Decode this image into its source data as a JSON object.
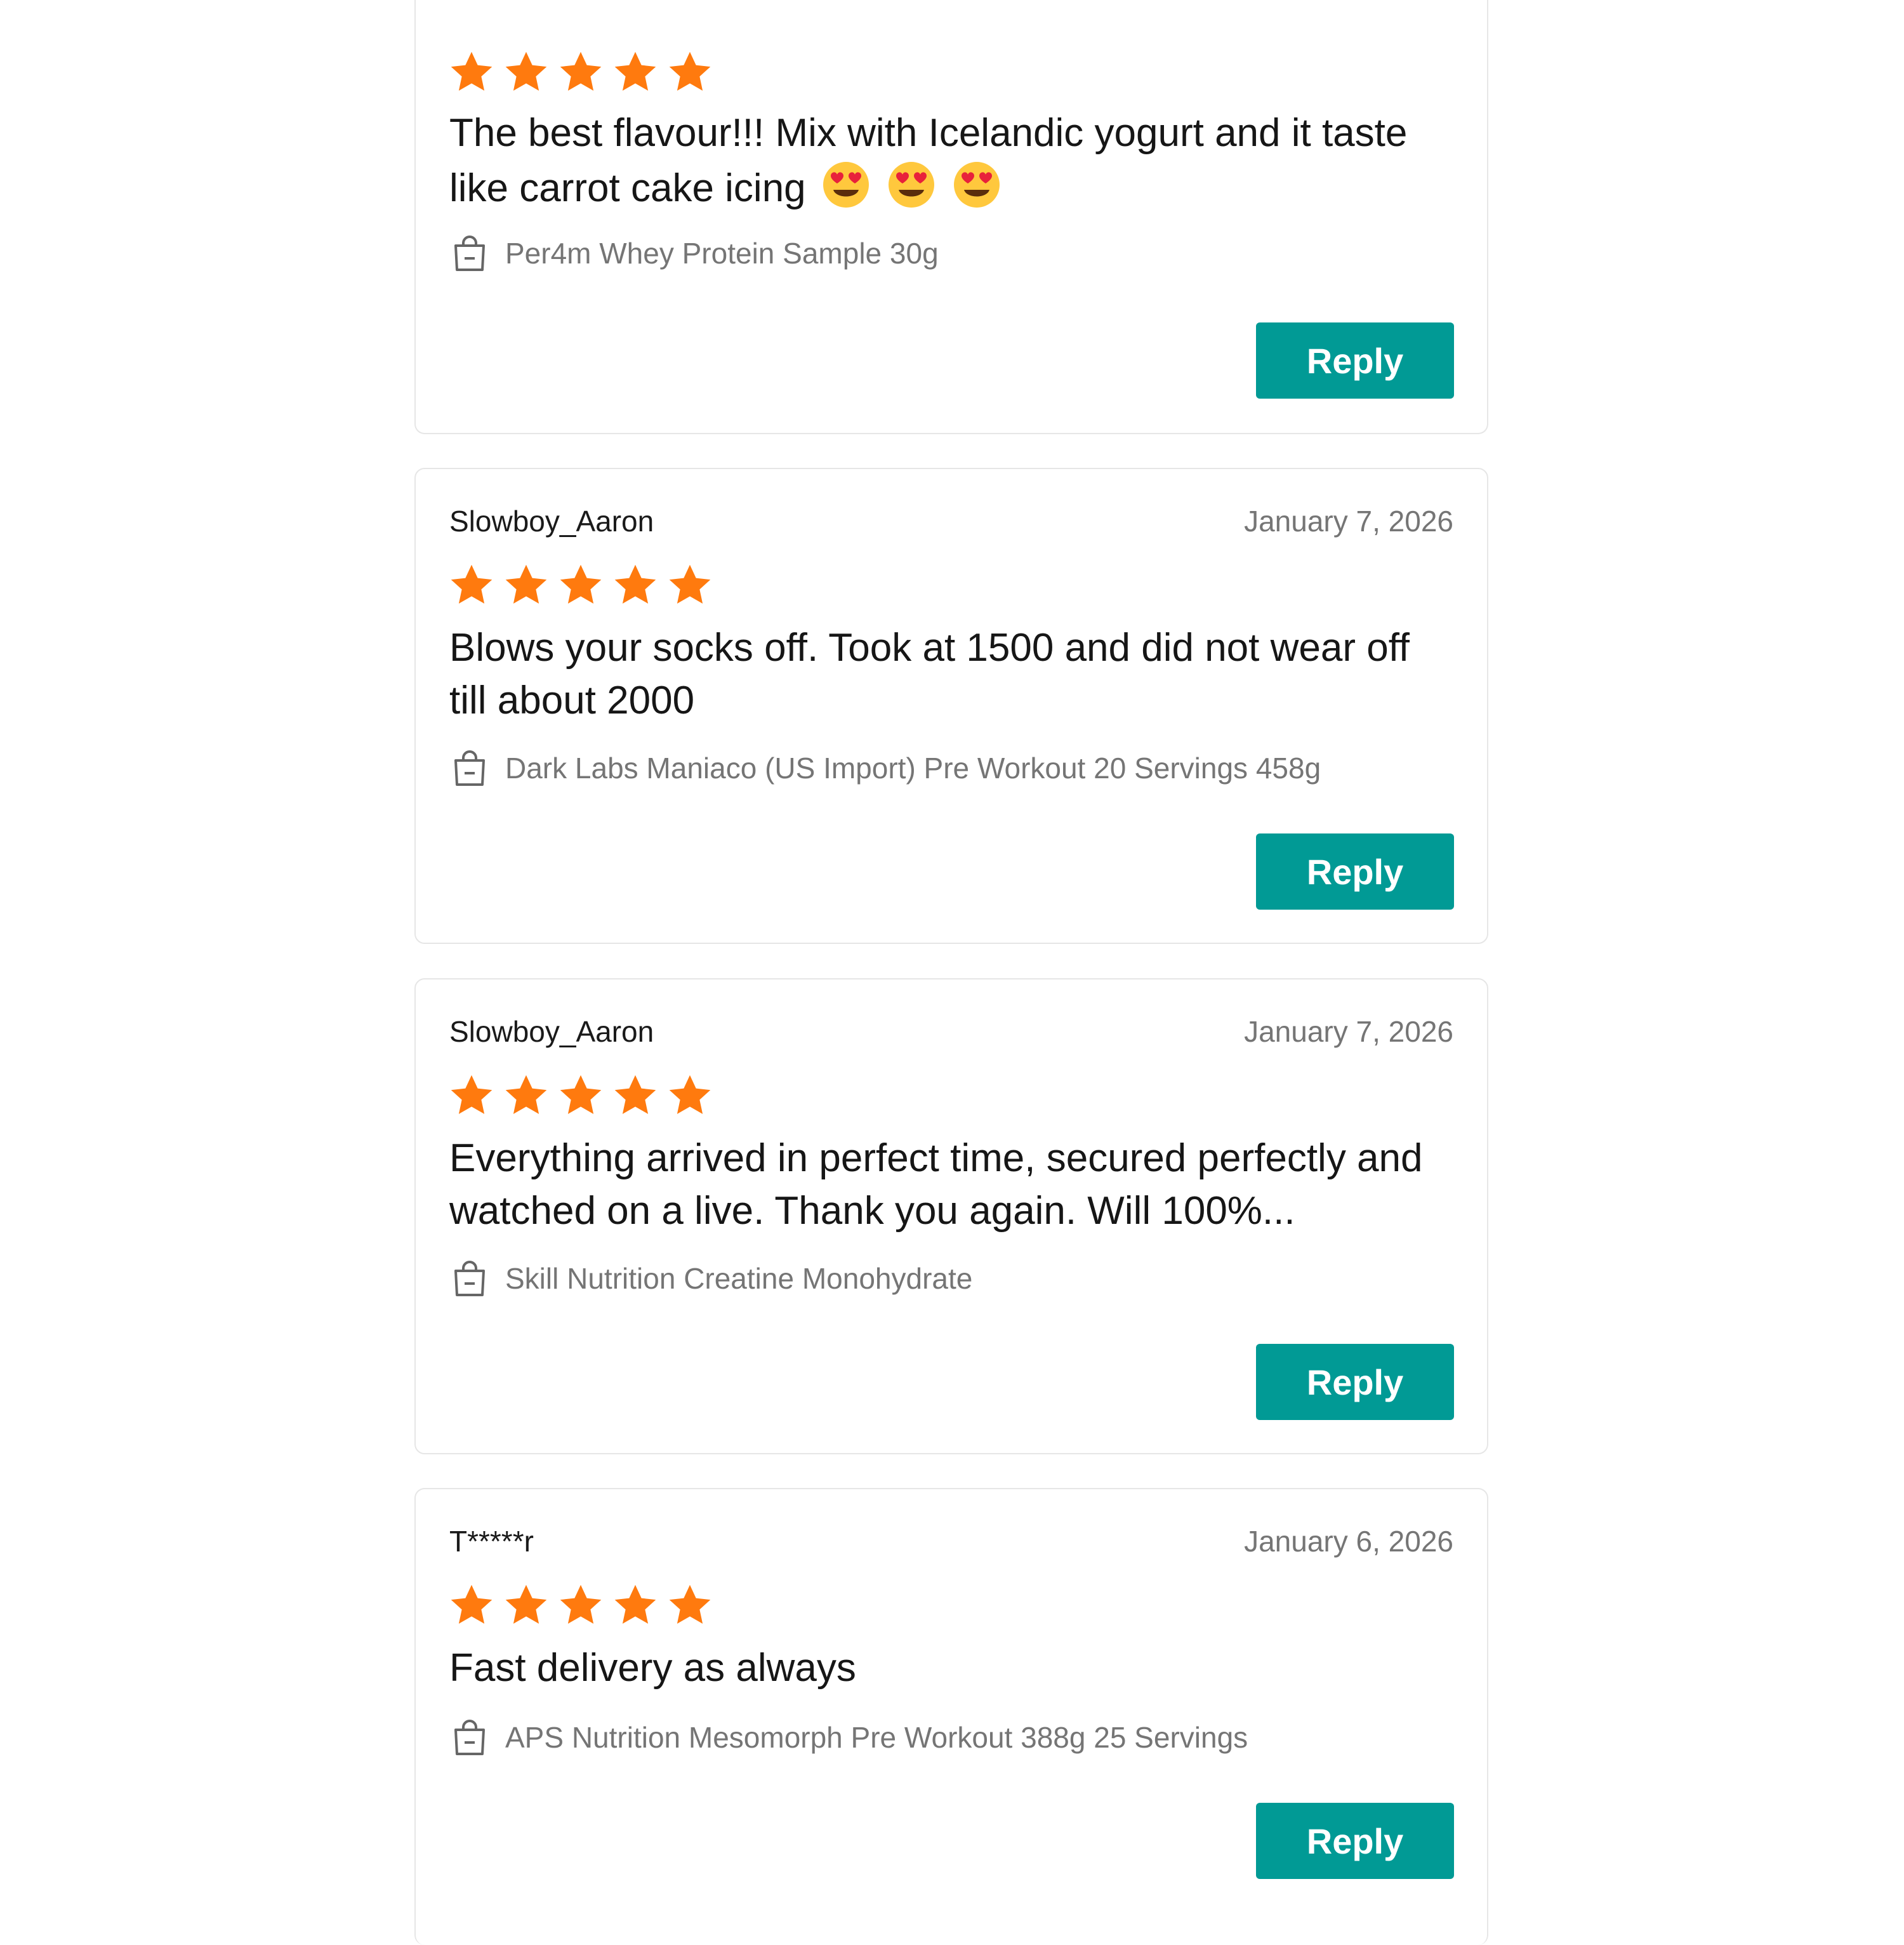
{
  "colors": {
    "star": "#ff7a0e",
    "reply_button": "#019a95",
    "card_border": "#e6e6e6",
    "secondary_text": "#757575"
  },
  "icons": {
    "rating": "star-icon",
    "product": "shopping-bag-icon",
    "emoji": "heart-eyes-emoji"
  },
  "reviews": [
    {
      "rating": 5,
      "text": "The best flavour!!! Mix with Icelandic yogurt and it taste like carrot cake icing",
      "emoji_count": 3,
      "product": "Per4m Whey Protein Sample 30g",
      "reply_label": "Reply"
    },
    {
      "reviewer": "Slowboy_Aaron",
      "date": "January 7, 2026",
      "rating": 5,
      "text": "Blows your socks off. Took at 1500 and did not wear off till about 2000",
      "product": "Dark Labs Maniaco (US Import) Pre Workout 20 Servings 458g",
      "reply_label": "Reply"
    },
    {
      "reviewer": "Slowboy_Aaron",
      "date": "January 7, 2026",
      "rating": 5,
      "text": "Everything arrived in perfect time, secured perfectly and watched on a live. Thank you again. Will 100%...",
      "product": "Skill Nutrition Creatine Monohydrate",
      "reply_label": "Reply"
    },
    {
      "reviewer": "T*****r",
      "date": "January 6, 2026",
      "rating": 5,
      "text": "Fast delivery as always",
      "product": "APS Nutrition Mesomorph Pre Workout 388g 25 Servings",
      "reply_label": "Reply"
    }
  ]
}
